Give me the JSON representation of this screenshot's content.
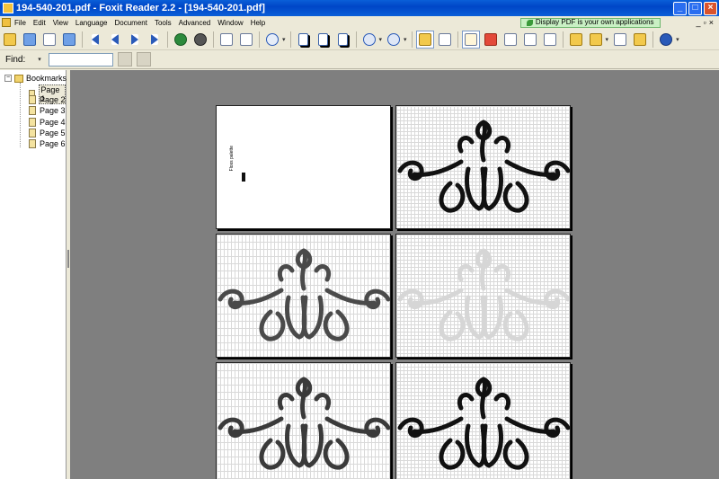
{
  "window": {
    "title": "194-540-201.pdf - Foxit Reader 2.2 - [194-540-201.pdf]",
    "min_glyph": "_",
    "max_glyph": "□",
    "close_glyph": "×"
  },
  "menu": {
    "items": [
      "File",
      "Edit",
      "View",
      "Language",
      "Document",
      "Tools",
      "Advanced",
      "Window",
      "Help"
    ],
    "ad_text": "Display PDF is your own applications",
    "mdi_min": "_",
    "mdi_restore": "▫",
    "mdi_close": "×"
  },
  "findbar": {
    "label": "Find:",
    "dropdown_glyph": "▾",
    "value": ""
  },
  "sidebar": {
    "root_label": "Bookmarks",
    "expander_glyph": "−",
    "items": [
      "Page 1",
      "Page 2",
      "Page 3",
      "Page 4",
      "Page 5",
      "Page 6"
    ],
    "selected_index": 0
  },
  "pages": [
    {
      "label": "page-1",
      "kind": "palette",
      "palette_label": "Floss palette"
    },
    {
      "label": "page-2",
      "kind": "motif",
      "color": "#111111"
    },
    {
      "label": "page-3",
      "kind": "motif",
      "color": "#4a4a4a"
    },
    {
      "label": "page-4",
      "kind": "motif",
      "color": "#d6d6d6"
    },
    {
      "label": "page-5",
      "kind": "motif",
      "color": "#3a3a3a"
    },
    {
      "label": "page-6",
      "kind": "motif",
      "color": "#111111"
    }
  ],
  "colors": {
    "titlebar": "#0a5fd8",
    "workspace": "#7f7f7f",
    "ad_background": "#c9f0c4"
  }
}
